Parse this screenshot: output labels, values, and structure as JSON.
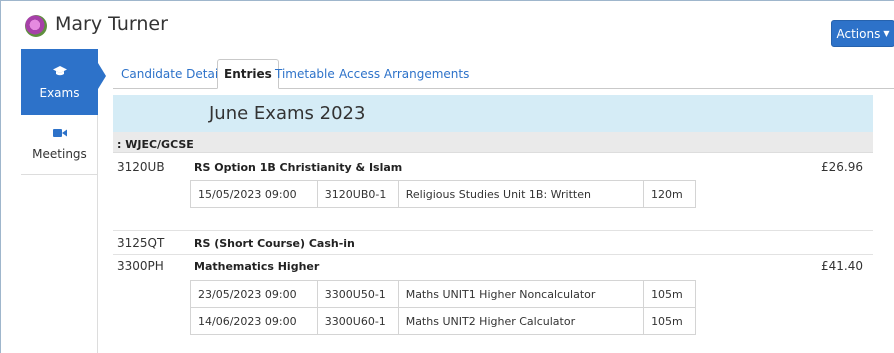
{
  "header": {
    "name": "Mary Turner",
    "actions_label": "Actions"
  },
  "sidebar": {
    "items": [
      {
        "label": "Exams",
        "icon": "graduation-cap-icon",
        "active": true
      },
      {
        "label": "Meetings",
        "icon": "video-camera-icon",
        "active": false
      }
    ]
  },
  "tabs": [
    {
      "label": "Candidate Details",
      "active": false
    },
    {
      "label": "Entries",
      "active": true
    },
    {
      "label": "Timetable",
      "active": false
    },
    {
      "label": "Access Arrangements",
      "active": false
    }
  ],
  "series_title": "June Exams 2023",
  "board": ": WJEC/GCSE",
  "entries": [
    {
      "code": "3120UB",
      "title": "RS Option 1B Christianity & Islam",
      "fee": "£26.96",
      "components": [
        {
          "datetime": "15/05/2023 09:00",
          "code": "3120UB0-1",
          "title": "Religious Studies Unit 1B: Written",
          "duration": "120m"
        }
      ]
    },
    {
      "code": "3125QT",
      "title": "RS (Short Course) Cash-in",
      "fee": "",
      "components": []
    },
    {
      "code": "3300PH",
      "title": "Mathematics Higher",
      "fee": "£41.40",
      "components": [
        {
          "datetime": "23/05/2023 09:00",
          "code": "3300U50-1",
          "title": "Maths UNIT1 Higher Noncalculator",
          "duration": "105m"
        },
        {
          "datetime": "14/06/2023 09:00",
          "code": "3300U60-1",
          "title": "Maths UNIT2 Higher Calculator",
          "duration": "105m"
        }
      ]
    }
  ],
  "colors": {
    "accent": "#2d72c9",
    "banner": "#d5ecf6",
    "board_row": "#eaeaea"
  }
}
